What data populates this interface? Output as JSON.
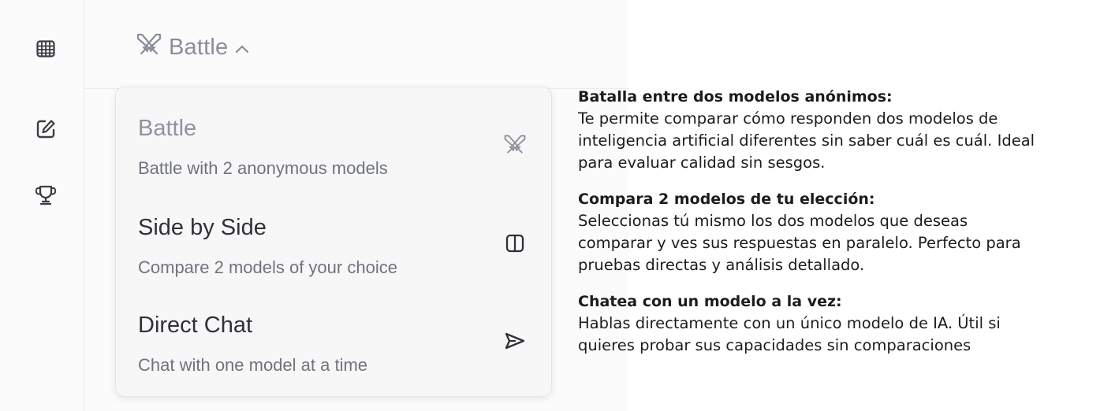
{
  "rail": {
    "icons": [
      "leaderboard-icon",
      "new-chat-icon",
      "trophy-icon"
    ]
  },
  "mode_selector": {
    "current_label": "Battle",
    "icon": "crossed-swords-icon",
    "chevron": "chevron-up-icon"
  },
  "dropdown": {
    "options": [
      {
        "title": "Battle",
        "subtitle": "Battle with 2 anonymous models",
        "icon": "crossed-swords-icon",
        "selected": true
      },
      {
        "title": "Side by Side",
        "subtitle": "Compare 2 models of your choice",
        "icon": "split-columns-icon",
        "selected": false
      },
      {
        "title": "Direct Chat",
        "subtitle": "Chat with one model at a time",
        "icon": "send-icon",
        "selected": false
      }
    ]
  },
  "notes": [
    {
      "heading": "Batalla entre dos modelos anónimos:",
      "lines": [
        "Te permite comparar cómo responden dos modelos de",
        "inteligencia artificial diferentes sin saber cuál es cuál. Ideal",
        "para evaluar calidad sin sesgos."
      ]
    },
    {
      "heading": "Compara 2 modelos de tu elección:",
      "lines": [
        "Seleccionas tú mismo los dos modelos que deseas",
        "comparar y ves sus respuestas en paralelo. Perfecto para",
        "pruebas directas y análisis detallado."
      ]
    },
    {
      "heading": "Chatea con un modelo a la vez:",
      "lines": [
        "Hablas directamente con un único modelo de IA. Útil si",
        "quieres probar sus capacidades sin comparaciones"
      ]
    }
  ],
  "colors": {
    "muted": "#8a8e98",
    "text": "#2f3138",
    "subtext": "#6f737c",
    "panel_bg": "#f7f7f8"
  }
}
